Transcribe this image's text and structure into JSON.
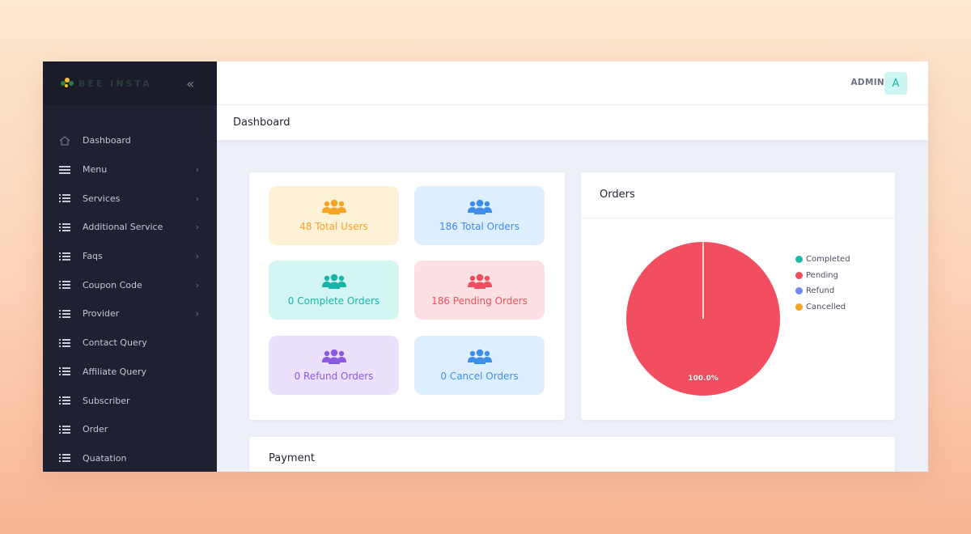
{
  "app": {
    "logo_text": "BEE INSTA"
  },
  "sidebar": {
    "items": [
      {
        "label": "Dashboard",
        "icon": "home-icon",
        "has_children": false
      },
      {
        "label": "Menu",
        "icon": "menu-icon",
        "has_children": true
      },
      {
        "label": "Services",
        "icon": "list-icon",
        "has_children": true
      },
      {
        "label": "Additional Service",
        "icon": "list-icon",
        "has_children": true
      },
      {
        "label": "Faqs",
        "icon": "list-icon",
        "has_children": true
      },
      {
        "label": "Coupon Code",
        "icon": "list-icon",
        "has_children": true
      },
      {
        "label": "Provider",
        "icon": "list-icon",
        "has_children": true
      },
      {
        "label": "Contact Query",
        "icon": "list-icon",
        "has_children": false
      },
      {
        "label": "Affiliate Query",
        "icon": "list-icon",
        "has_children": false
      },
      {
        "label": "Subscriber",
        "icon": "list-icon",
        "has_children": false
      },
      {
        "label": "Order",
        "icon": "list-icon",
        "has_children": false
      },
      {
        "label": "Quatation",
        "icon": "list-icon",
        "has_children": false
      }
    ]
  },
  "header": {
    "user_label": "ADMIN",
    "avatar_initial": "A"
  },
  "page": {
    "title": "Dashboard"
  },
  "stats": [
    {
      "label": "48 Total Users",
      "icon": "users-icon",
      "color": "#f5a524",
      "bg": "#fdf1d7"
    },
    {
      "label": "186 Total Orders",
      "icon": "users-icon",
      "color": "#3d8ee8",
      "bg": "#ddefff"
    },
    {
      "label": "0 Complete Orders",
      "icon": "users-icon",
      "color": "#19b4a8",
      "bg": "#d3f6f2"
    },
    {
      "label": "186 Pending Orders",
      "icon": "users-icon",
      "color": "#f04d5e",
      "bg": "#fde0e3"
    },
    {
      "label": "0 Refund Orders",
      "icon": "users-icon",
      "color": "#8a5ae0",
      "bg": "#ece1fc"
    },
    {
      "label": "0 Cancel Orders",
      "icon": "users-icon",
      "color": "#3d8ee8",
      "bg": "#ddefff"
    }
  ],
  "orders": {
    "title": "Orders",
    "chart_data": {
      "type": "pie",
      "categories": [
        "Completed",
        "Pending",
        "Refund",
        "Cancelled"
      ],
      "values": [
        0,
        186,
        0,
        0
      ],
      "colors": [
        "#1fb9a9",
        "#f24e60",
        "#6c8cf0",
        "#f5a524"
      ],
      "data_labels": [
        "",
        "100.0%",
        "",
        ""
      ],
      "legend_position": "right"
    }
  },
  "payment": {
    "title": "Payment"
  }
}
